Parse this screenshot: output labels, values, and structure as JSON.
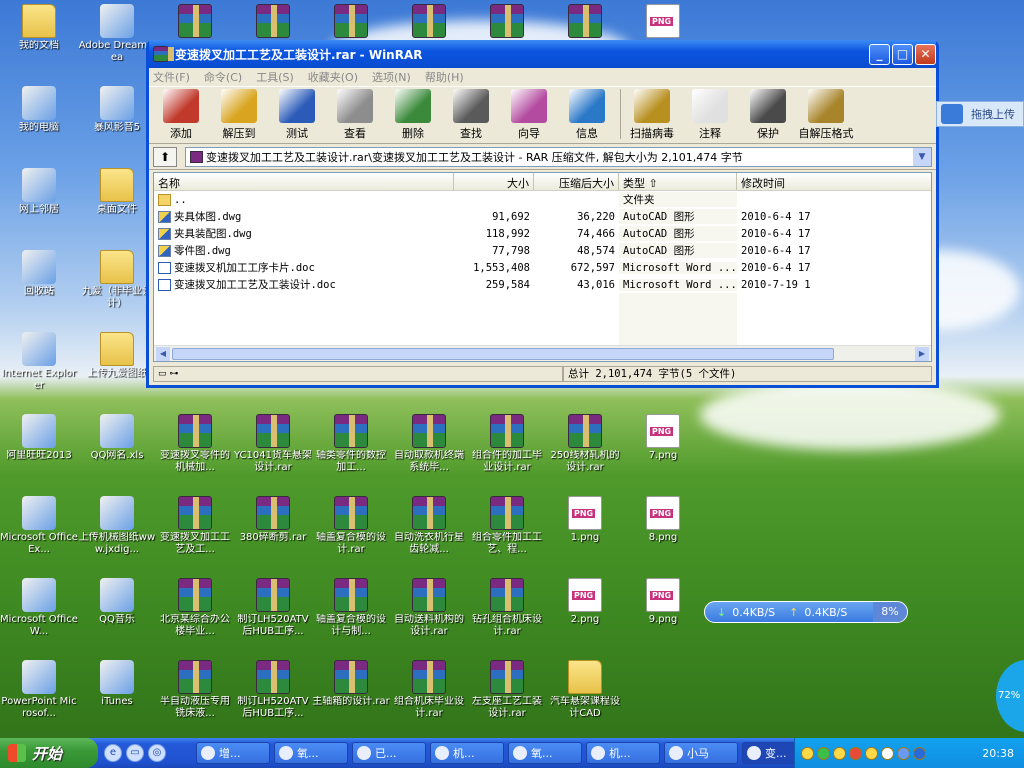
{
  "desktop": {
    "left_icons": [
      {
        "label": "我的文档",
        "kind": "folder",
        "name": "my-documents-icon"
      },
      {
        "label": "Adobe Dreamwea",
        "kind": "app",
        "name": "dreamweaver-icon"
      },
      {
        "label": "我的电脑",
        "kind": "app",
        "name": "my-computer-icon"
      },
      {
        "label": "暴风影音5",
        "kind": "app",
        "name": "storm-player-icon"
      },
      {
        "label": "网上邻居",
        "kind": "app",
        "name": "network-places-icon"
      },
      {
        "label": "桌面文件",
        "kind": "folder",
        "name": "desktop-files-folder-icon"
      },
      {
        "label": "回收站",
        "kind": "app",
        "name": "recycle-bin-icon"
      },
      {
        "label": "九爱（非毕业设计）",
        "kind": "folder",
        "name": "jiuai-folder-icon"
      },
      {
        "label": "Internet Explorer",
        "kind": "app",
        "name": "internet-explorer-icon"
      },
      {
        "label": "上传九爱图纸",
        "kind": "folder",
        "name": "upload-folder-icon"
      },
      {
        "label": "阿里旺旺2013",
        "kind": "app",
        "name": "aliwangwang-icon"
      },
      {
        "label": "QQ网名.xls",
        "kind": "app",
        "name": "excel-file-icon"
      },
      {
        "label": "Microsoft Office Ex...",
        "kind": "app",
        "name": "office-excel-icon"
      },
      {
        "label": "上传机械图纸www.jxdig...",
        "kind": "app",
        "name": "upload-site-icon"
      },
      {
        "label": "Microsoft Office W...",
        "kind": "app",
        "name": "office-word-icon"
      },
      {
        "label": "QQ音乐",
        "kind": "app",
        "name": "qq-music-icon"
      },
      {
        "label": "PowerPoint Microsof...",
        "kind": "app",
        "name": "powerpoint-icon"
      },
      {
        "label": "iTunes",
        "kind": "app",
        "name": "itunes-icon"
      }
    ],
    "grid_icons": [
      {
        "label": "",
        "kind": "rar"
      },
      {
        "label": "",
        "kind": "rar"
      },
      {
        "label": "",
        "kind": "rar"
      },
      {
        "label": "",
        "kind": "rar"
      },
      {
        "label": "",
        "kind": "rar"
      },
      {
        "label": "",
        "kind": "rar"
      },
      {
        "label": "",
        "kind": "png"
      },
      {
        "label": "变速拨叉零件的机械加...",
        "kind": "rar"
      },
      {
        "label": "YC1041货车悬架设计.rar",
        "kind": "rar"
      },
      {
        "label": "轴类零件的数控加工...",
        "kind": "rar"
      },
      {
        "label": "自动取款机终端系统毕...",
        "kind": "rar"
      },
      {
        "label": "组合件的加工毕业设计.rar",
        "kind": "rar"
      },
      {
        "label": "250线材轧机的设计.rar",
        "kind": "rar"
      },
      {
        "label": "7.png",
        "kind": "png"
      },
      {
        "label": "变速拨叉加工工艺及工...",
        "kind": "rar"
      },
      {
        "label": "380碎断剪.rar",
        "kind": "rar"
      },
      {
        "label": "轴盖复合模的设计.rar",
        "kind": "rar"
      },
      {
        "label": "自动洗衣机行星齿轮减...",
        "kind": "rar"
      },
      {
        "label": "组合零件加工工艺、程...",
        "kind": "rar"
      },
      {
        "label": "1.png",
        "kind": "png"
      },
      {
        "label": "8.png",
        "kind": "png"
      },
      {
        "label": "北京某综合办公楼毕业...",
        "kind": "rar"
      },
      {
        "label": "制订LH520ATV后HUB工序...",
        "kind": "rar"
      },
      {
        "label": "轴盖复合模的设计与制...",
        "kind": "rar"
      },
      {
        "label": "自动送料机构的设计.rar",
        "kind": "rar"
      },
      {
        "label": "钻孔组合机床设计.rar",
        "kind": "rar"
      },
      {
        "label": "2.png",
        "kind": "png"
      },
      {
        "label": "9.png",
        "kind": "png"
      },
      {
        "label": "半自动液压专用铣床液...",
        "kind": "rar"
      },
      {
        "label": "制订LH520ATV后HUB工序...",
        "kind": "rar"
      },
      {
        "label": "主轴箱的设计.rar",
        "kind": "rar"
      },
      {
        "label": "组合机床毕业设计.rar",
        "kind": "rar"
      },
      {
        "label": "左支座工艺工装设计.rar",
        "kind": "rar"
      },
      {
        "label": "汽车悬架课程设计CAD",
        "kind": "folder"
      },
      {
        "label": "",
        "kind": "none"
      }
    ]
  },
  "window": {
    "title": "变速拨叉加工工艺及工装设计.rar - WinRAR",
    "menu": [
      "文件(F)",
      "命令(C)",
      "工具(S)",
      "收藏夹(O)",
      "选项(N)",
      "帮助(H)"
    ],
    "toolbar": [
      "添加",
      "解压到",
      "测试",
      "查看",
      "删除",
      "查找",
      "向导",
      "信息",
      "扫描病毒",
      "注释",
      "保护",
      "自解压格式"
    ],
    "toolbar_colors": [
      "#c0392b",
      "#d9a520",
      "#2a5bb8",
      "#8d8d8d",
      "#3b8a3b",
      "#5a5a5a",
      "#b34ba0",
      "#2a78c8",
      "#b89020",
      "#e0e0e0",
      "#4a4a4a",
      "#a8852a"
    ],
    "address": "变速拨叉加工工艺及工装设计.rar\\变速拨叉加工工艺及工装设计 - RAR 压缩文件, 解包大小为 2,101,474 字节",
    "columns": [
      "名称",
      "大小",
      "压缩后大小",
      "类型",
      "修改时间"
    ],
    "files": [
      {
        "name": "..",
        "size": "",
        "packed": "",
        "type": "文件夹",
        "time": "",
        "icon": "fold"
      },
      {
        "name": "夹具体图.dwg",
        "size": "91,692",
        "packed": "36,220",
        "type": "AutoCAD 图形",
        "time": "2010-6-4 17",
        "icon": "dwg"
      },
      {
        "name": "夹具装配图.dwg",
        "size": "118,992",
        "packed": "74,466",
        "type": "AutoCAD 图形",
        "time": "2010-6-4 17",
        "icon": "dwg"
      },
      {
        "name": "零件图.dwg",
        "size": "77,798",
        "packed": "48,574",
        "type": "AutoCAD 图形",
        "time": "2010-6-4 17",
        "icon": "dwg"
      },
      {
        "name": "变速拨叉机加工工序卡片.doc",
        "size": "1,553,408",
        "packed": "672,597",
        "type": "Microsoft Word ...",
        "time": "2010-6-4 17",
        "icon": "doc"
      },
      {
        "name": "变速拨叉加工工艺及工装设计.doc",
        "size": "259,584",
        "packed": "43,016",
        "type": "Microsoft Word ...",
        "time": "2010-7-19 1",
        "icon": "doc"
      }
    ],
    "status_total": "总计 2,101,474 字节(5 个文件)"
  },
  "upload_widget": {
    "label": "拖拽上传"
  },
  "net_widget": {
    "down": "0.4KB/S",
    "up": "0.4KB/S",
    "pct": "8%"
  },
  "round_widget": {
    "pct": "72%"
  },
  "taskbar": {
    "start": "开始",
    "tasks": [
      "增...",
      "氧...",
      "已...",
      "机...",
      "氧...",
      "机...",
      "小马",
      "变..."
    ],
    "clock": "20:38"
  }
}
